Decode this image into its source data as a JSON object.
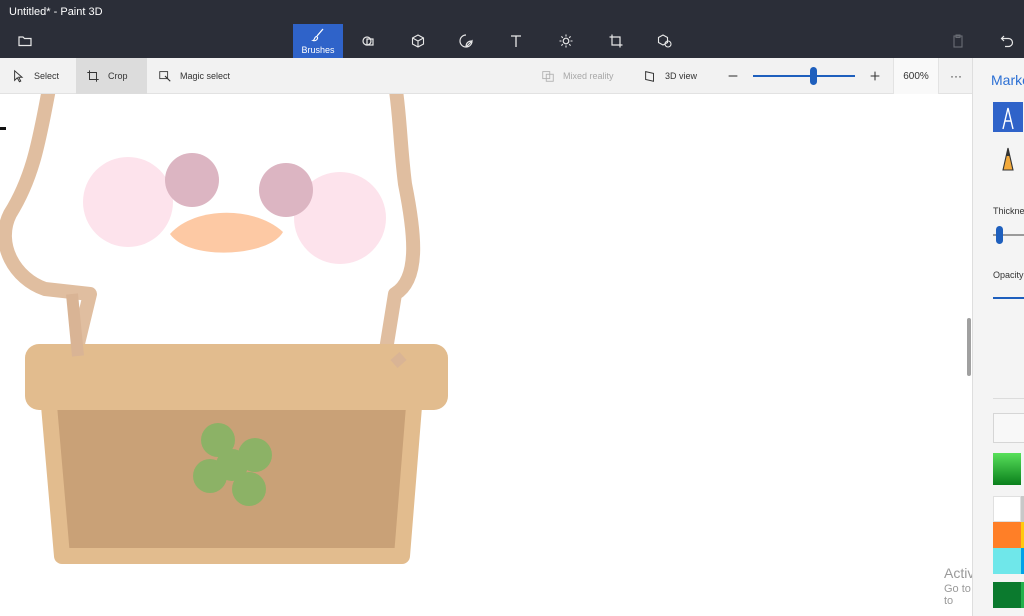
{
  "window": {
    "title": "Untitled* - Paint 3D"
  },
  "ribbon": {
    "active_tab_label": "Brushes",
    "tabs": [
      "brushes",
      "2d-shapes",
      "3d-shapes",
      "stickers",
      "text",
      "effects",
      "canvas",
      "3d-library"
    ]
  },
  "toolbar": {
    "select_label": "Select",
    "crop_label": "Crop",
    "magic_select_label": "Magic select",
    "mixed_reality_label": "Mixed reality",
    "view3d_label": "3D view",
    "zoom_value": "600%",
    "zoom_level": 0.6,
    "more_label": "···"
  },
  "panel": {
    "title": "Marke",
    "thickness_label": "Thicknes",
    "opacity_label": "Opacity",
    "colors": {
      "gradient_swatch": [
        "#58e05a",
        "#0a7f1c"
      ],
      "swatches": [
        "#ffffff",
        "#c8c8c8",
        "#ff7f27",
        "#ffc90e",
        "#6fe7ea",
        "#00a2e8",
        "#0b7a2e",
        "#22b14c"
      ]
    }
  },
  "canvas_art": {
    "body": "#ffffff",
    "outline": "#e0bea0",
    "cheeks": "#fde3ec",
    "eyes": "#dcb5c2",
    "beak": "#fdc9a4",
    "basket_rim": "#e2bc8e",
    "basket_body": "#c9a177",
    "clover": "#8cb266"
  },
  "watermark": {
    "line1": "Activate Wi",
    "line2": "Go to Settings to"
  }
}
